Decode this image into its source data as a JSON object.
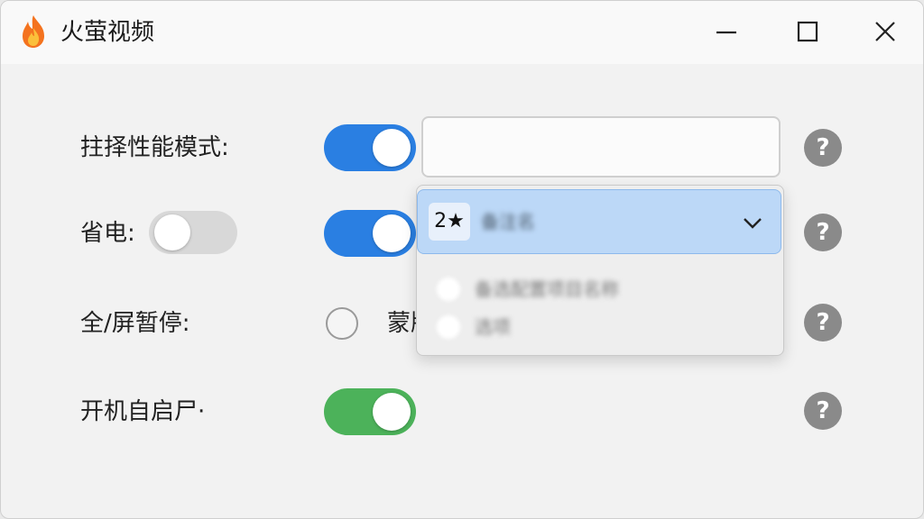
{
  "window": {
    "title": "火萤视频",
    "controls": {
      "minimize": "minimize",
      "maximize": "maximize",
      "close": "close"
    }
  },
  "settings": [
    {
      "label": "拄择性能模式:",
      "toggle_on": true,
      "toggle_color": "#2a7fe2"
    },
    {
      "label": "省电:",
      "inline_toggle_on": false,
      "toggle_on": true,
      "toggle_color": "#2a7fe2"
    },
    {
      "label": "全/屏暂停:",
      "radio_selected": false,
      "radio_partial_label": "蒙版"
    },
    {
      "label": "开机自启尸·",
      "toggle_on": true,
      "toggle_color": "#4cb25a"
    }
  ],
  "help_icon": "?",
  "dropdown": {
    "selected_badge": "2★",
    "selected_text": "备注名",
    "options": [
      "备选配置项目名称",
      "选项"
    ]
  },
  "colors": {
    "accent_blue": "#2a7fe2",
    "accent_green": "#4cb25a",
    "selected_row": "#bcd8f7",
    "help_gray": "#8a8a8a"
  }
}
